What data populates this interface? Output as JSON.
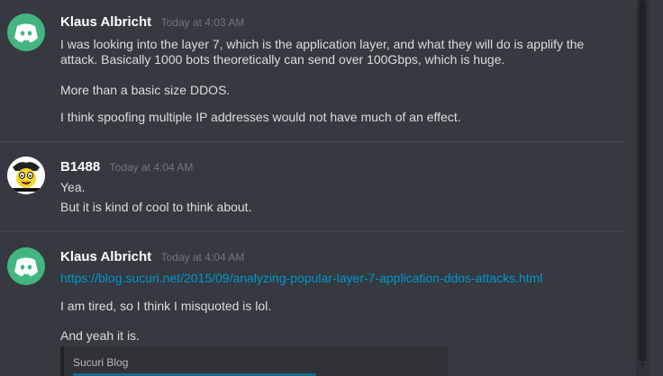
{
  "messages": [
    {
      "author": "Klaus Albricht",
      "timestamp": "Today at 4:03 AM",
      "avatar_icon": "discord-logo-icon",
      "lines": [
        "I was looking into the layer 7, which is the application layer, and what they will do is applify the",
        "attack. Basically 1000 bots theoretically can send over 100Gbps, which is huge.",
        "More than a basic size DDOS.",
        "I think spoofing multiple IP addresses would not have much of an effect."
      ]
    },
    {
      "author": "B1488",
      "timestamp": "Today at 4:04 AM",
      "avatar_icon": "cartoon-face-avatar-icon",
      "lines": [
        "Yea.",
        "But it is kind of cool to think about."
      ]
    },
    {
      "author": "Klaus Albricht",
      "timestamp": "Today at 4:04 AM",
      "avatar_icon": "discord-logo-icon",
      "link": "https://blog.sucuri.net/2015/09/analyzing-popular-layer-7-application-ddos-attacks.html",
      "lines": [
        "I am tired, so I think I misquoted is lol.",
        "And yeah it is."
      ],
      "embed": {
        "provider": "Sucuri Blog"
      }
    }
  ],
  "colors": {
    "background": "#36393f",
    "username": "#ffffff",
    "timestamp": "#72767d",
    "text": "#dcddde",
    "link": "#0096cf",
    "discord_green": "#43b581"
  }
}
